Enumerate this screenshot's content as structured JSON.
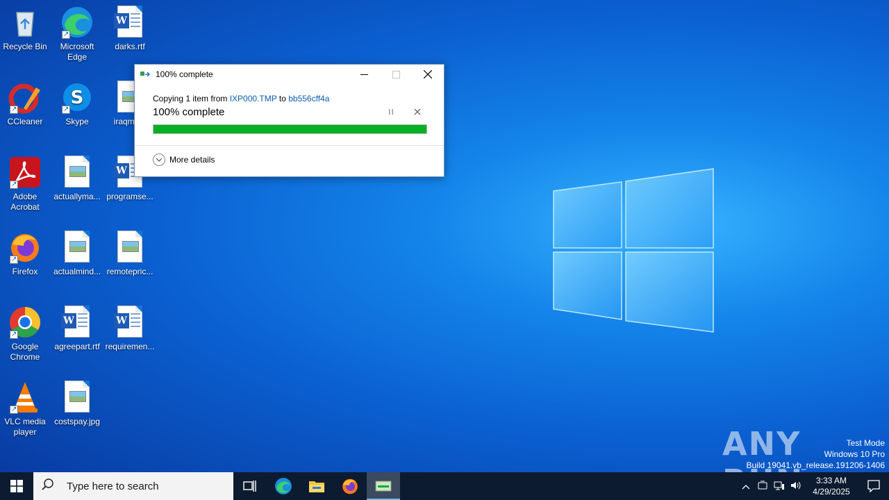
{
  "desktop": {
    "icons": [
      {
        "label": "Recycle Bin",
        "icon": "recycle-bin-icon"
      },
      {
        "label": "Microsoft Edge",
        "icon": "edge-icon"
      },
      {
        "label": "darks.rtf",
        "icon": "word-doc-icon"
      },
      {
        "label": "CCleaner",
        "icon": "ccleaner-icon"
      },
      {
        "label": "Skype",
        "icon": "skype-icon"
      },
      {
        "label": "iraqmo...",
        "icon": "image-file-icon"
      },
      {
        "label": "Adobe Acrobat",
        "icon": "acrobat-icon"
      },
      {
        "label": "actuallyma...",
        "icon": "image-file-icon"
      },
      {
        "label": "programse...",
        "icon": "word-doc-icon"
      },
      {
        "label": "Firefox",
        "icon": "firefox-icon"
      },
      {
        "label": "actualmind...",
        "icon": "image-file-icon"
      },
      {
        "label": "remotepric...",
        "icon": "image-file-icon"
      },
      {
        "label": "Google Chrome",
        "icon": "chrome-icon"
      },
      {
        "label": "agreepart.rtf",
        "icon": "word-doc-icon"
      },
      {
        "label": "requiremen...",
        "icon": "word-doc-icon"
      },
      {
        "label": "VLC media player",
        "icon": "vlc-icon"
      },
      {
        "label": "costspay.jpg",
        "icon": "image-file-icon"
      }
    ]
  },
  "dialog": {
    "title": "100% complete",
    "copy_prefix": "Copying 1 item from",
    "source": "IXP000.TMP",
    "to_word": "to",
    "destination": "bb556cff4a",
    "progress_text": "100% complete",
    "progress": 1.0,
    "more_details": "More details",
    "progress_color": "#06b025"
  },
  "watermark": {
    "brand": "ANY RUN",
    "mode": "Test Mode",
    "edition": "Windows 10 Pro",
    "build": "Build 19041.vb_release.191206-1406"
  },
  "taskbar": {
    "search_placeholder": "Type here to search",
    "time": "3:33 AM",
    "date": "4/29/2025"
  }
}
